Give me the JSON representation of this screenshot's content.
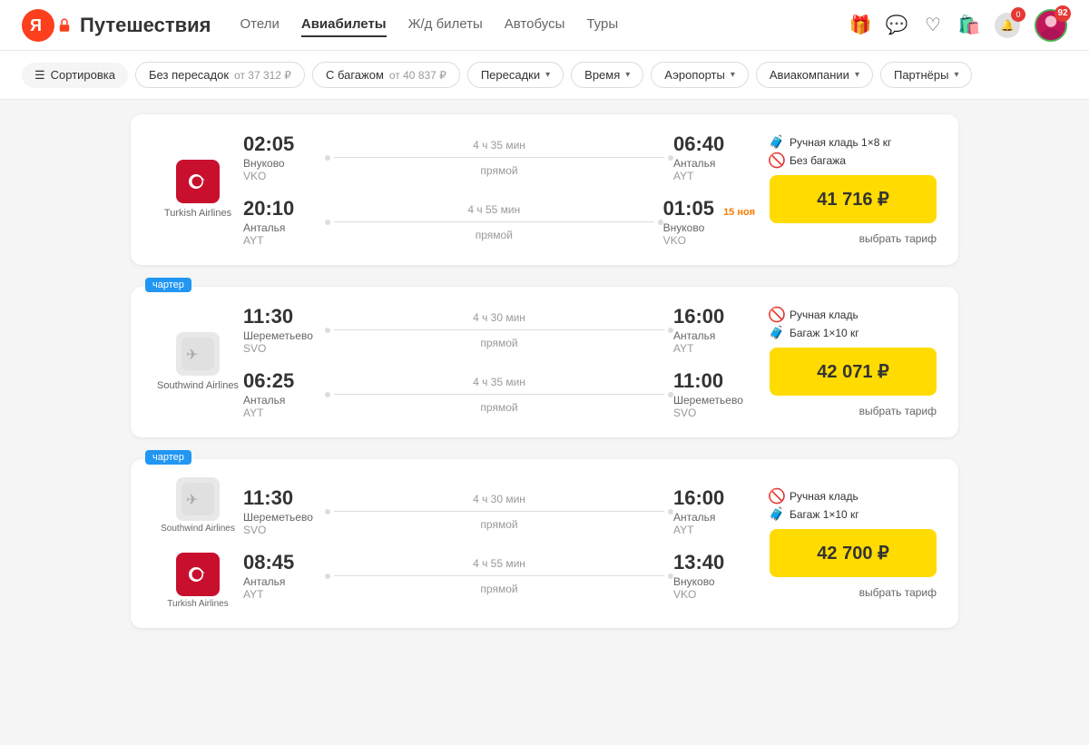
{
  "header": {
    "logo_text": "Путешествия",
    "nav_items": [
      {
        "label": "Отели",
        "active": false
      },
      {
        "label": "Авиабилеты",
        "active": true
      },
      {
        "label": "Ж/д билеты",
        "active": false
      },
      {
        "label": "Автобусы",
        "active": false
      },
      {
        "label": "Туры",
        "active": false
      }
    ],
    "notification_count": "0",
    "avatar_count": "92"
  },
  "filters": {
    "sort_label": "Сортировка",
    "no_transfer_label": "Без пересадок",
    "no_transfer_price": "от 37 312 ₽",
    "baggage_label": "С багажом",
    "baggage_price": "от 40 837 ₽",
    "transfers_label": "Пересадки",
    "time_label": "Время",
    "airports_label": "Аэропорты",
    "airlines_label": "Авиакомпании",
    "partners_label": "Партнёры"
  },
  "flights": [
    {
      "id": 1,
      "charter": false,
      "airline_name": "Turkish Airlines",
      "airline_type": "turkish",
      "segments": [
        {
          "depart_time": "02:05",
          "depart_city": "Внуково",
          "depart_code": "VKO",
          "duration": "4 ч 35 мин",
          "route_type": "прямой",
          "arrive_time": "06:40",
          "arrive_city": "Анталья",
          "arrive_code": "AYT",
          "next_day": false,
          "next_day_label": ""
        },
        {
          "depart_time": "20:10",
          "depart_city": "Анталья",
          "depart_code": "AYT",
          "duration": "4 ч 55 мин",
          "route_type": "прямой",
          "arrive_time": "01:05",
          "arrive_city": "Внуково",
          "arrive_code": "VKO",
          "next_day": true,
          "next_day_label": "15 ноя"
        }
      ],
      "baggage": [
        {
          "type": "carry_on",
          "label": "Ручная кладь 1×8 кг",
          "has": true
        },
        {
          "type": "checked",
          "label": "Без багажа",
          "has": false
        }
      ],
      "price": "41 716 ₽",
      "price_action": "выбрать тариф"
    },
    {
      "id": 2,
      "charter": true,
      "charter_label": "чартер",
      "airline_name": "Southwind Airlines",
      "airline_type": "southwind",
      "segments": [
        {
          "depart_time": "11:30",
          "depart_city": "Шереметьево",
          "depart_code": "SVO",
          "duration": "4 ч 30 мин",
          "route_type": "прямой",
          "arrive_time": "16:00",
          "arrive_city": "Анталья",
          "arrive_code": "AYT",
          "next_day": false,
          "next_day_label": ""
        },
        {
          "depart_time": "06:25",
          "depart_city": "Анталья",
          "depart_code": "AYT",
          "duration": "4 ч 35 мин",
          "route_type": "прямой",
          "arrive_time": "11:00",
          "arrive_city": "Шереметьево",
          "arrive_code": "SVO",
          "next_day": false,
          "next_day_label": ""
        }
      ],
      "baggage": [
        {
          "type": "carry_on",
          "label": "Ручная кладь",
          "has": false
        },
        {
          "type": "checked",
          "label": "Багаж 1×10 кг",
          "has": true
        }
      ],
      "price": "42 071 ₽",
      "price_action": "выбрать тариф"
    },
    {
      "id": 3,
      "charter": true,
      "charter_label": "чартер",
      "airline_name_1": "Southwind Airlines",
      "airline_type_1": "southwind",
      "airline_name_2": "Turkish Airlines",
      "airline_type_2": "turkish",
      "mixed": true,
      "segments": [
        {
          "depart_time": "11:30",
          "depart_city": "Шереметьево",
          "depart_code": "SVO",
          "duration": "4 ч 30 мин",
          "route_type": "прямой",
          "arrive_time": "16:00",
          "arrive_city": "Анталья",
          "arrive_code": "AYT",
          "next_day": false,
          "next_day_label": "",
          "airline_type": "southwind",
          "airline_name": "Southwind Airlines"
        },
        {
          "depart_time": "08:45",
          "depart_city": "Анталья",
          "depart_code": "AYT",
          "duration": "4 ч 55 мин",
          "route_type": "прямой",
          "arrive_time": "13:40",
          "arrive_city": "Внуково",
          "arrive_code": "VKO",
          "next_day": false,
          "next_day_label": "",
          "airline_type": "turkish",
          "airline_name": "Turkish Airlines"
        }
      ],
      "baggage": [
        {
          "type": "carry_on",
          "label": "Ручная кладь",
          "has": false
        },
        {
          "type": "checked",
          "label": "Багаж 1×10 кг",
          "has": true
        }
      ],
      "price": "42 700 ₽",
      "price_action": "выбрать тариф"
    }
  ]
}
